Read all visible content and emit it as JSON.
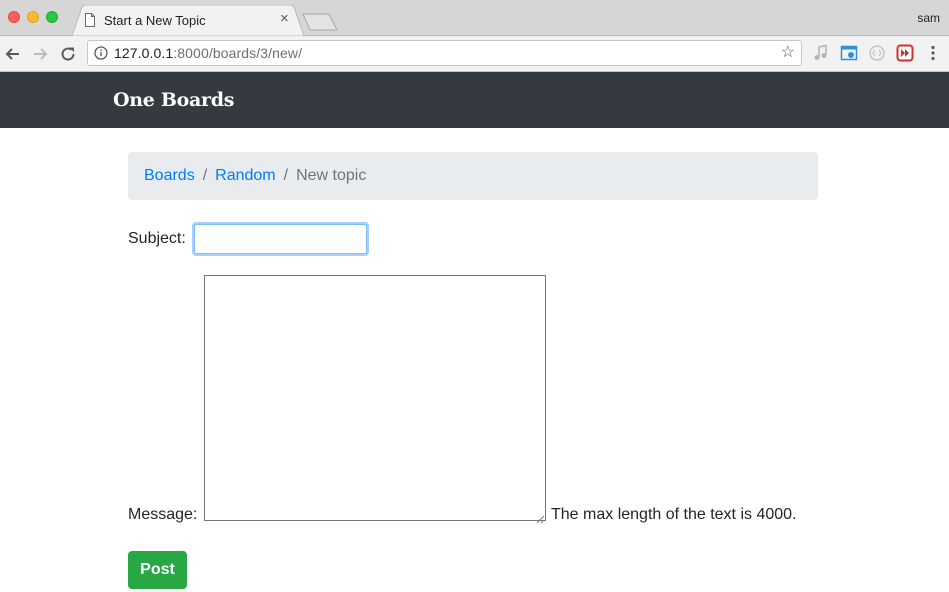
{
  "browser": {
    "tab_title": "Start a New Topic",
    "tab_close": "×",
    "profile_name": "sam",
    "url_host": "127.0.0.1",
    "url_rest": ":8000/boards/3/new/",
    "bookmark_star": "☆"
  },
  "navbar": {
    "brand": "One Boards"
  },
  "breadcrumb": {
    "items": [
      "Boards",
      "Random"
    ],
    "separator": "/",
    "active": "New topic"
  },
  "form": {
    "subject_label": "Subject:",
    "subject_value": "",
    "message_label": "Message:",
    "message_value": "",
    "message_hint": "The max length of the text is 4000.",
    "submit_label": "Post"
  },
  "colors": {
    "navbar_bg": "#343a40",
    "link": "#007bff",
    "breadcrumb_bg": "#e9ecef",
    "success": "#28a745"
  },
  "icons": [
    "page-icon",
    "back-arrow-icon",
    "forward-arrow-icon",
    "reload-icon",
    "info-icon",
    "star-icon",
    "music-extension-icon",
    "screenshot-extension-icon",
    "circle-extension-icon",
    "red-extension-icon",
    "kebab-menu-icon",
    "resize-grip-icon"
  ]
}
